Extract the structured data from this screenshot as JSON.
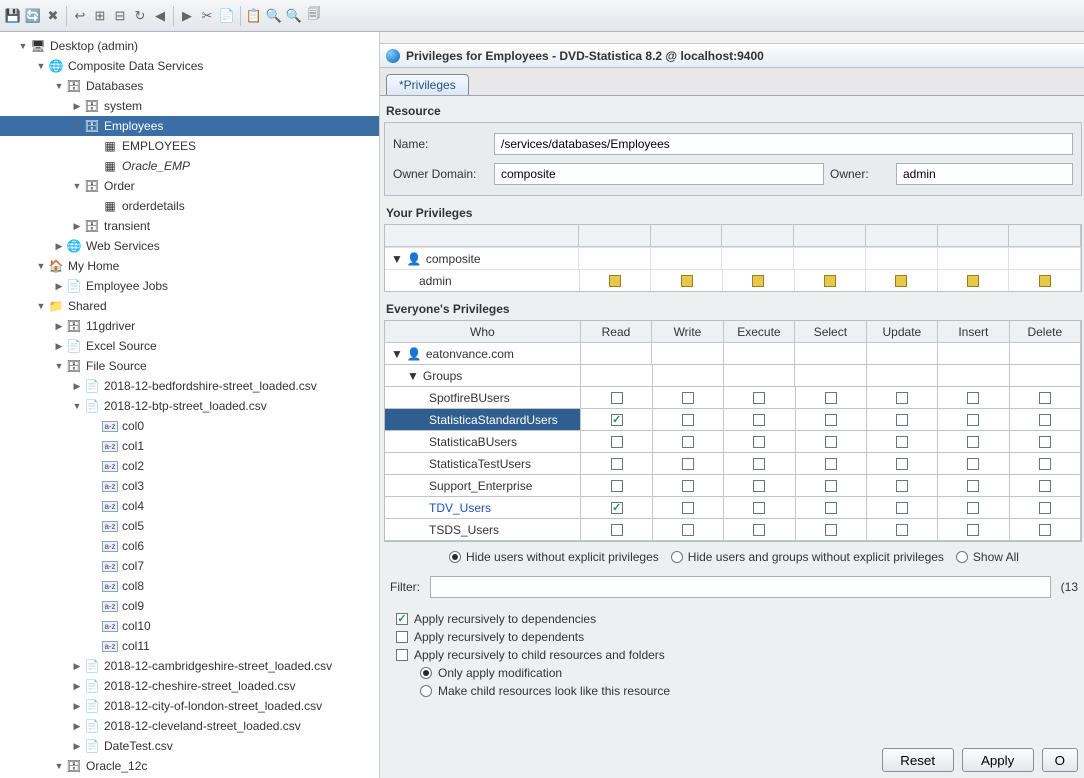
{
  "toolbar_icons": [
    "💾",
    "🔄",
    "✖",
    "↩",
    "⊞",
    "⊟",
    "↻",
    "◀",
    "▶",
    "✂",
    "📄",
    "📋",
    "🔍",
    "🔍",
    "🗐"
  ],
  "tree": [
    {
      "d": 0,
      "t": "▼",
      "i": "🖥",
      "l": "Desktop (admin)"
    },
    {
      "d": 1,
      "t": "▼",
      "i": "🌐",
      "l": "Composite Data Services"
    },
    {
      "d": 2,
      "t": "▼",
      "i": "🗄",
      "l": "Databases"
    },
    {
      "d": 3,
      "t": "▶",
      "i": "🗄",
      "l": "system"
    },
    {
      "d": 3,
      "t": "▼",
      "i": "🗄",
      "l": "Employees",
      "sel": true
    },
    {
      "d": 4,
      "t": "",
      "i": "▦",
      "l": "EMPLOYEES"
    },
    {
      "d": 4,
      "t": "",
      "i": "▦",
      "l": "Oracle_EMP",
      "italic": true
    },
    {
      "d": 3,
      "t": "▼",
      "i": "🗄",
      "l": "Order"
    },
    {
      "d": 4,
      "t": "",
      "i": "▦",
      "l": "orderdetails"
    },
    {
      "d": 3,
      "t": "▶",
      "i": "🗄",
      "l": "transient"
    },
    {
      "d": 2,
      "t": "▶",
      "i": "🌐",
      "l": "Web Services"
    },
    {
      "d": 1,
      "t": "▼",
      "i": "🏠",
      "l": "My Home"
    },
    {
      "d": 2,
      "t": "▶",
      "i": "📄",
      "l": "Employee Jobs"
    },
    {
      "d": 1,
      "t": "▼",
      "i": "📁",
      "l": "Shared"
    },
    {
      "d": 2,
      "t": "▶",
      "i": "🗄",
      "l": "11gdriver"
    },
    {
      "d": 2,
      "t": "▶",
      "i": "📄",
      "l": "Excel Source"
    },
    {
      "d": 2,
      "t": "▼",
      "i": "🗄",
      "l": "File Source"
    },
    {
      "d": 3,
      "t": "▶",
      "i": "📄",
      "l": "2018-12-bedfordshire-street_loaded.csv"
    },
    {
      "d": 3,
      "t": "▼",
      "i": "📄",
      "l": "2018-12-btp-street_loaded.csv"
    },
    {
      "d": 4,
      "t": "",
      "i": "az",
      "l": "col0"
    },
    {
      "d": 4,
      "t": "",
      "i": "az",
      "l": "col1"
    },
    {
      "d": 4,
      "t": "",
      "i": "az",
      "l": "col2"
    },
    {
      "d": 4,
      "t": "",
      "i": "az",
      "l": "col3"
    },
    {
      "d": 4,
      "t": "",
      "i": "az",
      "l": "col4"
    },
    {
      "d": 4,
      "t": "",
      "i": "az",
      "l": "col5"
    },
    {
      "d": 4,
      "t": "",
      "i": "az",
      "l": "col6"
    },
    {
      "d": 4,
      "t": "",
      "i": "az",
      "l": "col7"
    },
    {
      "d": 4,
      "t": "",
      "i": "az",
      "l": "col8"
    },
    {
      "d": 4,
      "t": "",
      "i": "az",
      "l": "col9"
    },
    {
      "d": 4,
      "t": "",
      "i": "az",
      "l": "col10"
    },
    {
      "d": 4,
      "t": "",
      "i": "az",
      "l": "col11"
    },
    {
      "d": 3,
      "t": "▶",
      "i": "📄",
      "l": "2018-12-cambridgeshire-street_loaded.csv"
    },
    {
      "d": 3,
      "t": "▶",
      "i": "📄",
      "l": "2018-12-cheshire-street_loaded.csv"
    },
    {
      "d": 3,
      "t": "▶",
      "i": "📄",
      "l": "2018-12-city-of-london-street_loaded.csv"
    },
    {
      "d": 3,
      "t": "▶",
      "i": "📄",
      "l": "2018-12-cleveland-street_loaded.csv"
    },
    {
      "d": 3,
      "t": "▶",
      "i": "📄",
      "l": "DateTest.csv"
    },
    {
      "d": 2,
      "t": "▼",
      "i": "🗄",
      "l": "Oracle_12c"
    }
  ],
  "dlg_title": "Privileges for Employees - DVD-Statistica 8.2 @ localhost:9400",
  "tab_label": "*Privileges",
  "resource": {
    "section": "Resource",
    "name_label": "Name:",
    "name": "/services/databases/Employees",
    "domain_label": "Owner Domain:",
    "domain": "composite",
    "owner_label": "Owner:",
    "owner": "admin"
  },
  "your_priv_section": "Your Privileges",
  "your_priv": {
    "domain": "composite",
    "user": "admin"
  },
  "everyone_section": "Everyone's Privileges",
  "perm_headers": [
    "Who",
    "Read",
    "Write",
    "Execute",
    "Select",
    "Update",
    "Insert",
    "Delete"
  ],
  "ep_domain": "eatonvance.com",
  "ep_group_label": "Groups",
  "ep_rows": [
    {
      "name": "SpotfireBUsers",
      "perms": [
        0,
        0,
        0,
        0,
        0,
        0,
        0
      ]
    },
    {
      "name": "StatisticaStandardUsers",
      "perms": [
        1,
        0,
        0,
        0,
        0,
        0,
        0
      ],
      "sel": true
    },
    {
      "name": "StatisticaBUsers",
      "perms": [
        0,
        0,
        0,
        0,
        0,
        0,
        0
      ]
    },
    {
      "name": "StatisticaTestUsers",
      "perms": [
        0,
        0,
        0,
        0,
        0,
        0,
        0
      ]
    },
    {
      "name": "Support_Enterprise",
      "perms": [
        0,
        0,
        0,
        0,
        0,
        0,
        0
      ]
    },
    {
      "name": "TDV_Users",
      "perms": [
        1,
        0,
        0,
        0,
        0,
        0,
        0
      ],
      "link": true
    },
    {
      "name": "TSDS_Users",
      "perms": [
        0,
        0,
        0,
        0,
        0,
        0,
        0
      ]
    }
  ],
  "filter_opts": {
    "r1": "Hide users without explicit privileges",
    "r2": "Hide users and groups without explicit privileges",
    "r3": "Show All"
  },
  "filter_label": "Filter:",
  "filter_count": "(13",
  "apply_opts": {
    "a1": "Apply recursively to dependencies",
    "a2": "Apply recursively to dependents",
    "a3": "Apply recursively to child resources and folders",
    "sub1": "Only apply modification",
    "sub2": "Make child resources look like this resource"
  },
  "buttons": {
    "reset": "Reset",
    "apply": "Apply",
    "ok": "O"
  }
}
